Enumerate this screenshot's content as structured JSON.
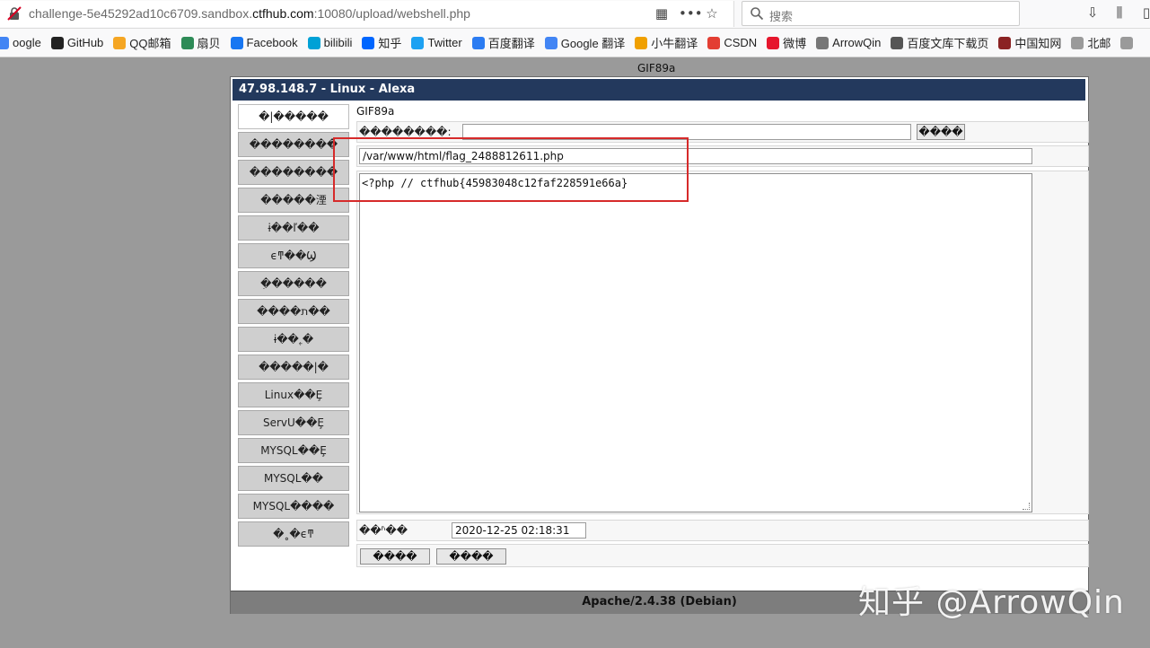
{
  "browser": {
    "url_path_prefix": "challenge-5e45292ad10c6709.sandbox.",
    "url_host": "ctfhub.com",
    "url_suffix": ":10080/upload/webshell.php",
    "search_placeholder": "搜索",
    "bookmarks": [
      {
        "label": "oogle",
        "icon": "google-icon",
        "color": "#4285f4"
      },
      {
        "label": "GitHub",
        "icon": "github-icon",
        "color": "#222222"
      },
      {
        "label": "QQ邮箱",
        "icon": "qq-mail-icon",
        "color": "#f5a623"
      },
      {
        "label": "扇贝",
        "icon": "shanbay-icon",
        "color": "#2e8b57"
      },
      {
        "label": "Facebook",
        "icon": "facebook-icon",
        "color": "#1877f2"
      },
      {
        "label": "bilibili",
        "icon": "bilibili-icon",
        "color": "#00a1d6"
      },
      {
        "label": "知乎",
        "icon": "zhihu-icon",
        "color": "#0066ff"
      },
      {
        "label": "Twitter",
        "icon": "twitter-icon",
        "color": "#1da1f2"
      },
      {
        "label": "百度翻译",
        "icon": "baidu-translate-icon",
        "color": "#2b7cf2"
      },
      {
        "label": "Google 翻译",
        "icon": "google-translate-icon",
        "color": "#4285f4"
      },
      {
        "label": "小牛翻译",
        "icon": "niutrans-icon",
        "color": "#f0a000"
      },
      {
        "label": "CSDN",
        "icon": "csdn-icon",
        "color": "#e33e33"
      },
      {
        "label": "微博",
        "icon": "weibo-icon",
        "color": "#e6162d"
      },
      {
        "label": "ArrowQin",
        "icon": "arrowqin-icon",
        "color": "#777777"
      },
      {
        "label": "百度文库下载页",
        "icon": "globe-icon",
        "color": "#555555"
      },
      {
        "label": "中国知网",
        "icon": "cnki-icon",
        "color": "#8b2323"
      },
      {
        "label": "北邮",
        "icon": "folder-icon",
        "color": "#9a9a9a"
      },
      {
        "label": "",
        "icon": "folder-icon",
        "color": "#9a9a9a"
      }
    ]
  },
  "page": {
    "gif_header_top": "GIF89a",
    "panel_title": "47.98.148.7 - Linux - Alexa",
    "footer": "Apache/2.4.38 (Debian)",
    "nav": [
      "�|�����",
      "��������",
      "��������",
      "�����湮",
      "ɨ��ľ��",
      "ϵͳ��Ϣ",
      "ִ������",
      "����ת��",
      "ɨ��˿�",
      "�����|�",
      "Linux��Ȩ",
      "ServU��Ȩ",
      "MYSQL��Ȩ",
      "MYSQL��",
      "MYSQL����",
      "�˳�ϵͳ"
    ],
    "gif_header_inner": "GIF89a",
    "row1_label": "��������:",
    "row1_input": "",
    "row1_button": "����",
    "path_value": "/var/www/html/flag_2488812611.php",
    "file_content": "<?php // ctfhub{45983048c12faf228591e66a}",
    "time_label": "�޸�ʱ��",
    "time_value": "2020-12-25 02:18:31",
    "save_button": "����",
    "back_button": "����"
  },
  "watermark": "知乎 @ArrowQin",
  "colors": {
    "title_bar": "#23395d",
    "highlight": "#d62a2a",
    "footer": "#7d7d7d"
  }
}
